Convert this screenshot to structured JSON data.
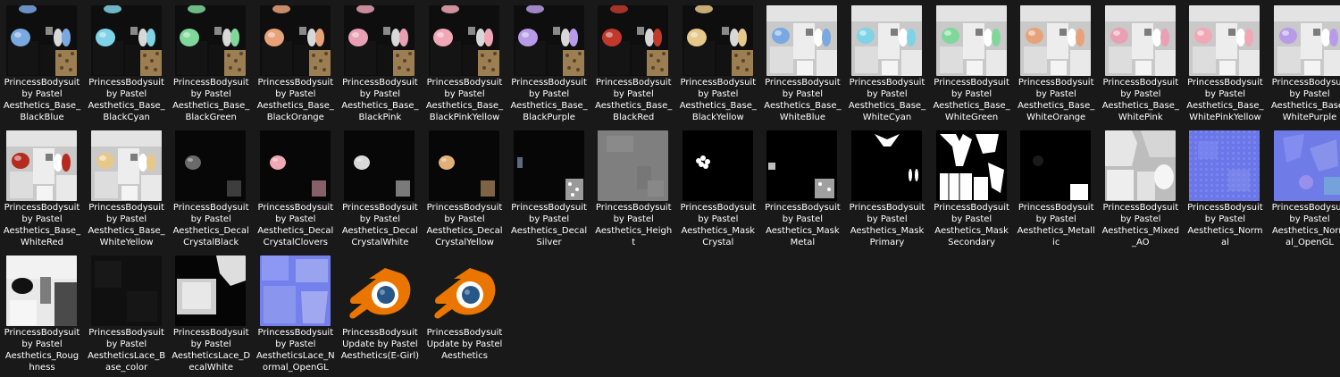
{
  "files": [
    {
      "label": "PrincessBodysuit\nby Pastel\nAesthetics_Base_\nBlackBlue",
      "kind": "base-black",
      "accent": "#7aa8e0"
    },
    {
      "label": "PrincessBodysuit\nby Pastel\nAesthetics_Base_\nBlackCyan",
      "kind": "base-black",
      "accent": "#7fd3e6"
    },
    {
      "label": "PrincessBodysuit\nby Pastel\nAesthetics_Base_\nBlackGreen",
      "kind": "base-black",
      "accent": "#7fd89a"
    },
    {
      "label": "PrincessBodysuit\nby Pastel\nAesthetics_Base_\nBlackOrange",
      "kind": "base-black",
      "accent": "#e8a27a"
    },
    {
      "label": "PrincessBodysuit\nby Pastel\nAesthetics_Base_\nBlackPink",
      "kind": "base-black",
      "accent": "#eaa0b4"
    },
    {
      "label": "PrincessBodysuit\nby Pastel\nAesthetics_Base_\nBlackPinkYellow",
      "kind": "base-black",
      "accent": "#f0a8b6"
    },
    {
      "label": "PrincessBodysuit\nby Pastel\nAesthetics_Base_\nBlackPurple",
      "kind": "base-black",
      "accent": "#b89be8"
    },
    {
      "label": "PrincessBodysuit\nby Pastel\nAesthetics_Base_\nBlackRed",
      "kind": "base-black",
      "accent": "#c0392b"
    },
    {
      "label": "PrincessBodysuit\nby Pastel\nAesthetics_Base_\nBlackYellow",
      "kind": "base-black",
      "accent": "#e6c98a"
    },
    {
      "label": "PrincessBodysuit\nby Pastel\nAesthetics_Base_\nWhiteBlue",
      "kind": "base-white",
      "accent": "#7aa8e0"
    },
    {
      "label": "PrincessBodysuit\nby Pastel\nAesthetics_Base_\nWhiteCyan",
      "kind": "base-white",
      "accent": "#7fd3e6"
    },
    {
      "label": "PrincessBodysuit\nby Pastel\nAesthetics_Base_\nWhiteGreen",
      "kind": "base-white",
      "accent": "#7fd89a"
    },
    {
      "label": "PrincessBodysuit\nby Pastel\nAesthetics_Base_\nWhiteOrange",
      "kind": "base-white",
      "accent": "#e8a27a"
    },
    {
      "label": "PrincessBodysuit\nby Pastel\nAesthetics_Base_\nWhitePink",
      "kind": "base-white",
      "accent": "#eaa0b4"
    },
    {
      "label": "PrincessBodysuit\nby Pastel\nAesthetics_Base_\nWhitePinkYellow",
      "kind": "base-white",
      "accent": "#f0a8b6"
    },
    {
      "label": "PrincessBodysuit\nby Pastel\nAesthetics_Base_\nWhitePurple",
      "kind": "base-white",
      "accent": "#b89be8"
    },
    {
      "label": "PrincessBodysuit\nby Pastel\nAesthetics_Base_\nWhiteRed",
      "kind": "base-white",
      "accent": "#b52b20"
    },
    {
      "label": "PrincessBodysuit\nby Pastel\nAesthetics_Base_\nWhiteYellow",
      "kind": "base-white",
      "accent": "#e6c98a"
    },
    {
      "label": "PrincessBodysuit\nby Pastel\nAesthetics_Decal\nCrystalBlack",
      "kind": "decal",
      "accent": "#6a6a6a"
    },
    {
      "label": "PrincessBodysuit\nby Pastel\nAesthetics_Decal\nCrystalClovers",
      "kind": "decal",
      "accent": "#f0a8b6"
    },
    {
      "label": "PrincessBodysuit\nby Pastel\nAesthetics_Decal\nCrystalWhite",
      "kind": "decal",
      "accent": "#d8d8d8"
    },
    {
      "label": "PrincessBodysuit\nby Pastel\nAesthetics_Decal\nCrystalYellow",
      "kind": "decal",
      "accent": "#e0b078"
    },
    {
      "label": "PrincessBodysuit\nby Pastel\nAesthetics_Decal\nSilver",
      "kind": "decal-silver",
      "accent": "#c8c8c8"
    },
    {
      "label": "PrincessBodysuit\nby Pastel\nAesthetics_Heigh\nt",
      "kind": "height",
      "accent": "#8a8a8a"
    },
    {
      "label": "PrincessBodysuit\nby Pastel\nAesthetics_Mask\nCrystal",
      "kind": "mask-crystal",
      "accent": "#ffffff"
    },
    {
      "label": "PrincessBodysuit\nby Pastel\nAesthetics_Mask\nMetal",
      "kind": "mask-metal",
      "accent": "#ffffff"
    },
    {
      "label": "PrincessBodysuit\nby Pastel\nAesthetics_Mask\nPrimary",
      "kind": "mask-primary",
      "accent": "#ffffff"
    },
    {
      "label": "PrincessBodysuit\nby Pastel\nAesthetics_Mask\nSecondary",
      "kind": "mask-secondary",
      "accent": "#ffffff"
    },
    {
      "label": "PrincessBodysuit\nby Pastel\nAesthetics_Metall\nic",
      "kind": "metallic",
      "accent": "#ffffff"
    },
    {
      "label": "PrincessBodysuit\nby Pastel\nAesthetics_Mixed\n_AO",
      "kind": "ao",
      "accent": "#dcdcdc"
    },
    {
      "label": "PrincessBodysuit\nby Pastel\nAesthetics_Norm\nal",
      "kind": "normal",
      "accent": "#6f7cf0"
    },
    {
      "label": "PrincessBodysuit\nby Pastel\nAesthetics_Norm\nal_OpenGL",
      "kind": "normal-gl",
      "accent": "#7a86f0"
    },
    {
      "label": "PrincessBodysuit\nby Pastel\nAesthetics_Roug\nhness",
      "kind": "roughness",
      "accent": "#e0e0e0"
    },
    {
      "label": "PrincessBodysuit\nby Pastel\nAestheticsLace_B\nase_color",
      "kind": "lace-base",
      "accent": "#222222"
    },
    {
      "label": "PrincessBodysuit\nby Pastel\nAestheticsLace_D\necalWhite",
      "kind": "lace-decal",
      "accent": "#e8e8e8"
    },
    {
      "label": "PrincessBodysuit\nby Pastel\nAestheticsLace_N\normal_OpenGL",
      "kind": "lace-normal",
      "accent": "#7a86f0"
    },
    {
      "label": "PrincessBodysuit\nUpdate by Pastel\nAesthetics(E-Girl)",
      "kind": "blender",
      "accent": "#ea7600"
    },
    {
      "label": "PrincessBodysuit\nUpdate by Pastel\nAesthetics",
      "kind": "blender",
      "accent": "#ea7600"
    }
  ]
}
